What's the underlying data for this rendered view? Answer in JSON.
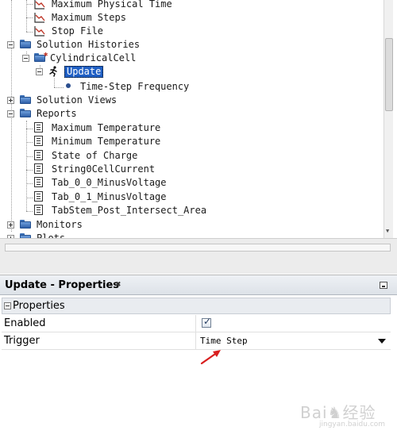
{
  "tree": {
    "items": [
      {
        "label": "Maximum Physical Time",
        "icon": "chart-icon"
      },
      {
        "label": "Maximum Steps",
        "icon": "chart-icon"
      },
      {
        "label": "Stop File",
        "icon": "chart-icon"
      },
      {
        "label": "Solution Histories",
        "icon": "folder-icon"
      },
      {
        "label": "CylindricalCell",
        "icon": "history-folder-icon"
      },
      {
        "label": "Update",
        "icon": "running-man-icon"
      },
      {
        "label": "Time-Step Frequency",
        "icon": "bullet-icon"
      },
      {
        "label": "Solution Views",
        "icon": "folder-icon"
      },
      {
        "label": "Reports",
        "icon": "folder-icon"
      },
      {
        "label": "Maximum Temperature",
        "icon": "report-icon"
      },
      {
        "label": "Minimum Temperature",
        "icon": "report-icon"
      },
      {
        "label": "State of Charge",
        "icon": "report-icon"
      },
      {
        "label": "String0CellCurrent",
        "icon": "report-icon"
      },
      {
        "label": "Tab_0_0_MinusVoltage",
        "icon": "report-icon"
      },
      {
        "label": "Tab_0_1_MinusVoltage",
        "icon": "report-icon"
      },
      {
        "label": "TabStem_Post_Intersect_Area",
        "icon": "report-icon"
      },
      {
        "label": "Monitors",
        "icon": "folder-icon"
      },
      {
        "label": "Plots",
        "icon": "folder-icon"
      }
    ],
    "selected_item": "Update"
  },
  "properties": {
    "title": "Update - Properties",
    "close_glyph": "✖",
    "section_label": "Properties",
    "rows": [
      {
        "name": "Enabled",
        "checked": true
      },
      {
        "name": "Trigger",
        "value": "Time Step"
      }
    ]
  },
  "watermark": {
    "text": "Bai♞经验",
    "sub": "jingyan.baidu.com"
  },
  "colors": {
    "selection": "#1f5fc4",
    "annotation": "#d81e1e",
    "folder": "#3a6fb5"
  }
}
